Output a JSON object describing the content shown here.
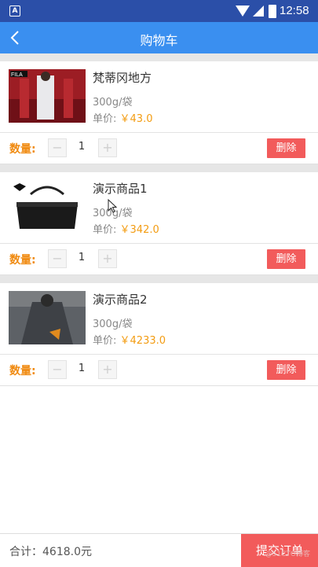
{
  "status_bar": {
    "app_letter": "A",
    "time": "12:58"
  },
  "header": {
    "title": "购物车"
  },
  "items": [
    {
      "name": "梵蒂冈地方",
      "weight": "300g/袋",
      "price_label": "单价:",
      "price": "￥43.0",
      "qty_label": "数量:",
      "qty": "1",
      "minus": "−",
      "plus": "+",
      "delete_label": "删除",
      "thumb_text": "FILA"
    },
    {
      "name": "演示商品1",
      "weight": "300g/袋",
      "price_label": "单价:",
      "price": "￥342.0",
      "qty_label": "数量:",
      "qty": "1",
      "minus": "−",
      "plus": "+",
      "delete_label": "删除",
      "thumb_text": ""
    },
    {
      "name": "演示商品2",
      "weight": "300g/袋",
      "price_label": "单价:",
      "price": "￥4233.0",
      "qty_label": "数量:",
      "qty": "1",
      "minus": "−",
      "plus": "+",
      "delete_label": "删除",
      "thumb_text": ""
    }
  ],
  "footer": {
    "total": "合计：4618.0元",
    "submit": "提交订单"
  },
  "watermark": "@51CTO博客",
  "colors": {
    "status_bar": "#2b4fa8",
    "header": "#3a8ff0",
    "accent": "#f39c12",
    "delete": "#f25b5b"
  }
}
